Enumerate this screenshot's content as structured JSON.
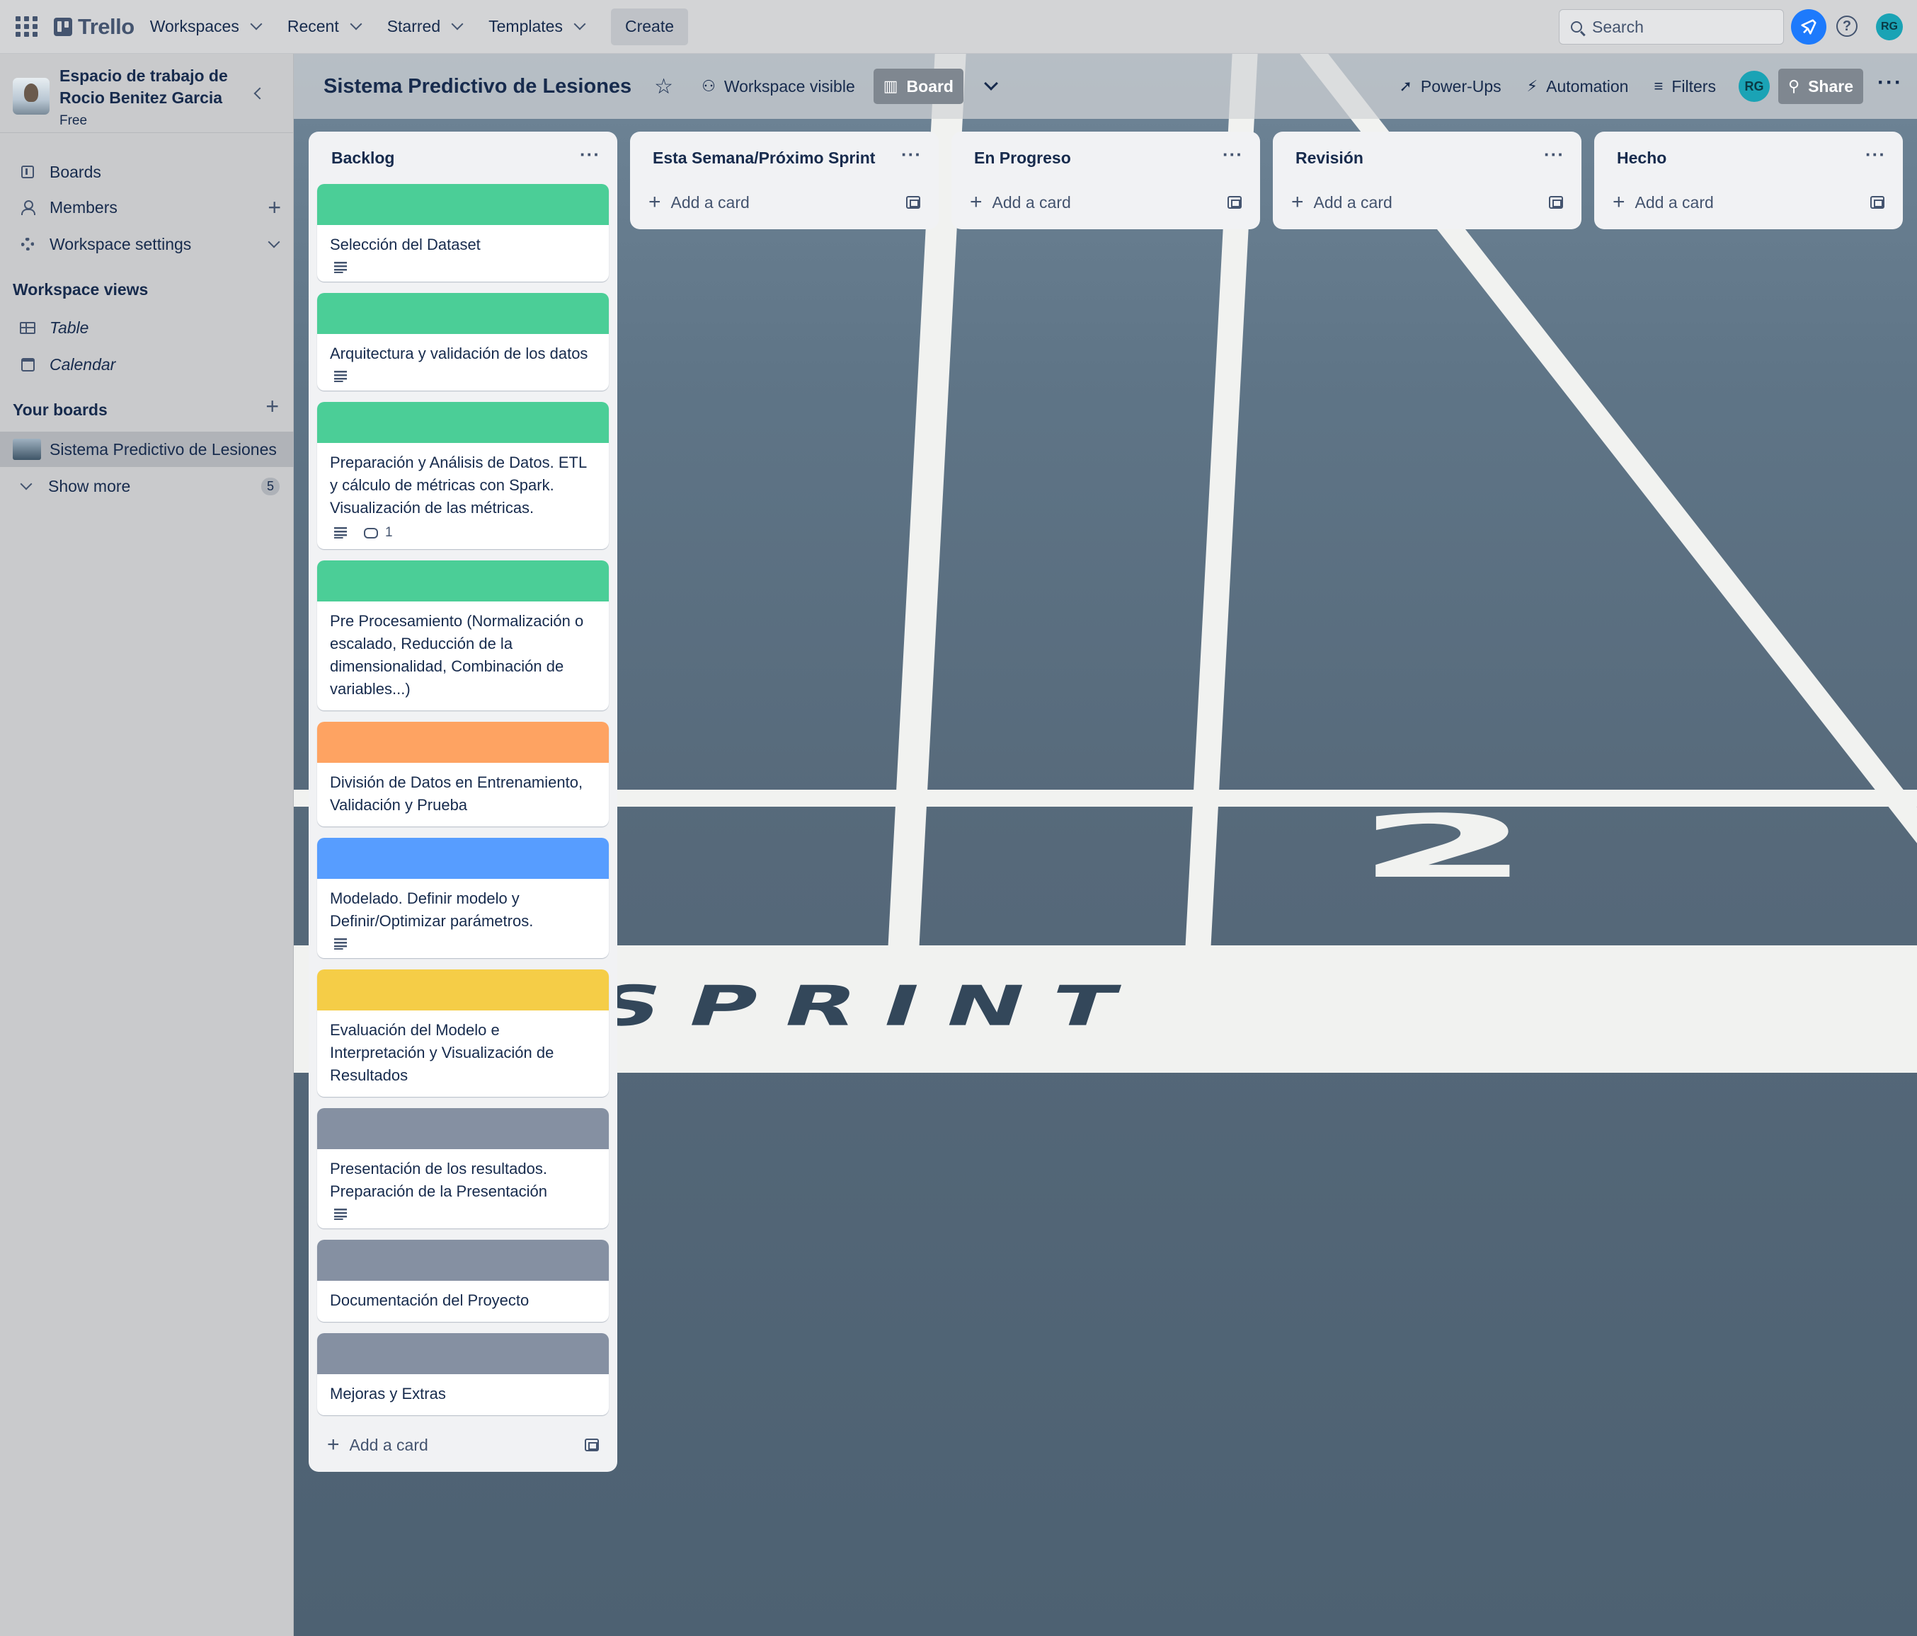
{
  "topbar": {
    "logo": "Trello",
    "nav": [
      "Workspaces",
      "Recent",
      "Starred",
      "Templates"
    ],
    "create": "Create",
    "search_placeholder": "Search",
    "avatar": "RG"
  },
  "sidebar": {
    "workspace_name": "Espacio de trabajo de Rocio Benitez Garcia",
    "plan": "Free",
    "items": {
      "boards": "Boards",
      "members": "Members",
      "settings": "Workspace settings"
    },
    "views_title": "Workspace views",
    "views": [
      "Table",
      "Calendar"
    ],
    "your_boards_title": "Your boards",
    "current_board": "Sistema Predictivo de Lesiones",
    "show_more": "Show more",
    "show_more_count": "5"
  },
  "board": {
    "title": "Sistema Predictivo de Lesiones",
    "visibility": "Workspace visible",
    "view": "Board",
    "powerups": "Power-Ups",
    "automation": "Automation",
    "filters": "Filters",
    "avatar": "RG",
    "share": "Share"
  },
  "lists": [
    {
      "name": "Backlog",
      "add_card": "Add a card",
      "cards": [
        {
          "text": "Selección del Dataset",
          "cover": "#4bce97",
          "description": true
        },
        {
          "text": "Arquitectura y validación de los datos",
          "cover": "#4bce97",
          "description": true
        },
        {
          "text": "Preparación y Análisis de Datos. ETL y cálculo de métricas con Spark. Visualización de las métricas.",
          "cover": "#4bce97",
          "description": true,
          "comments": "1"
        },
        {
          "text": "Pre Procesamiento (Normalización o escalado, Reducción de la dimensionalidad, Combinación de variables...)",
          "cover": "#4bce97",
          "description": false
        },
        {
          "text": "División de Datos en Entrenamiento, Validación y Prueba",
          "cover": "#fea362",
          "description": false
        },
        {
          "text": "Modelado. Definir modelo y Definir/Optimizar parámetros.",
          "cover": "#579dff",
          "description": true
        },
        {
          "text": "Evaluación del Modelo e Interpretación y Visualización de Resultados",
          "cover": "#f5cd47",
          "description": false
        },
        {
          "text": "Presentación de los resultados. Preparación de la Presentación",
          "cover": "#8590a2",
          "description": true
        },
        {
          "text": "Documentación del Proyecto",
          "cover": "#8590a2",
          "description": false
        },
        {
          "text": "Mejoras y Extras",
          "cover": "#8590a2",
          "description": false
        }
      ]
    },
    {
      "name": "Esta Semana/Próximo Sprint",
      "add_card": "Add a card",
      "cards": []
    },
    {
      "name": "En Progreso",
      "add_card": "Add a card",
      "cards": []
    },
    {
      "name": "Revisión",
      "add_card": "Add a card",
      "cards": []
    },
    {
      "name": "Hecho",
      "add_card": "Add a card",
      "cards": []
    }
  ],
  "background_text": {
    "number": "2",
    "word": "SPRINT"
  }
}
